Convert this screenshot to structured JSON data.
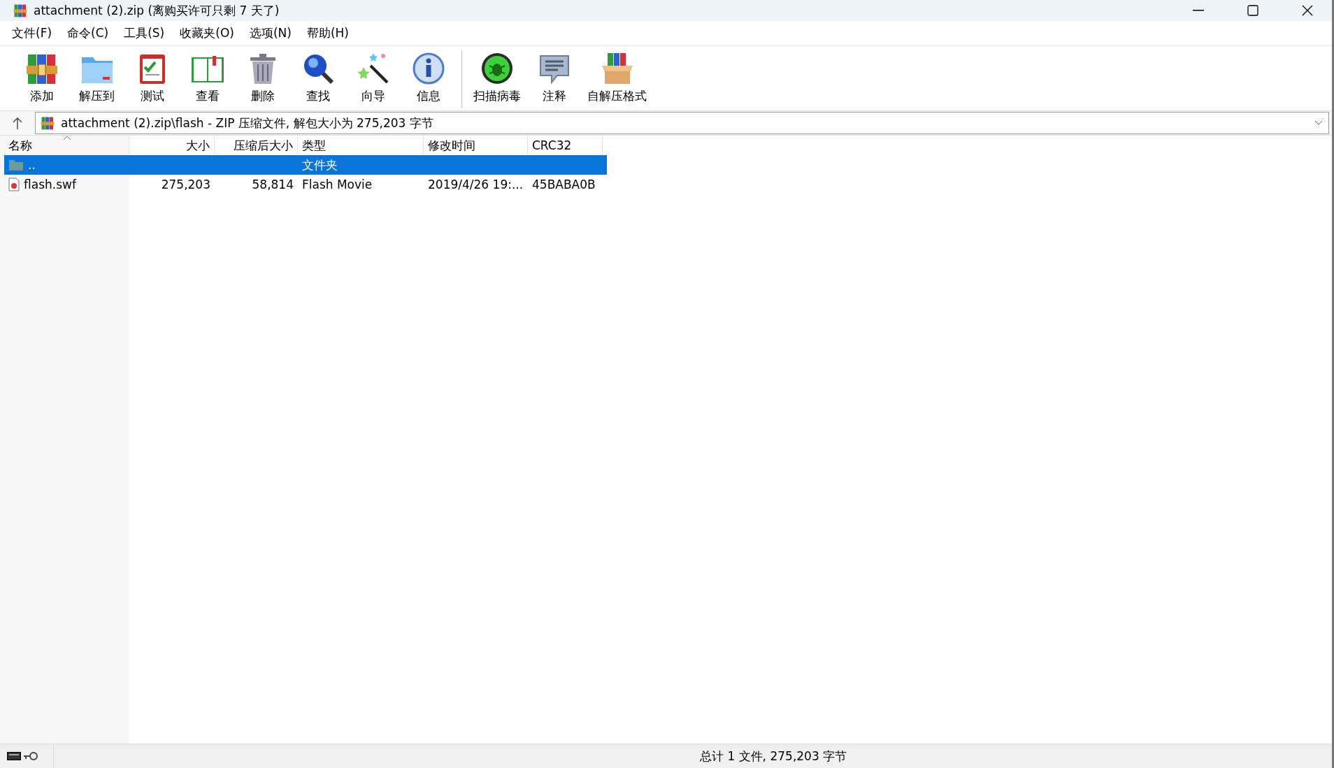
{
  "window": {
    "title": "attachment (2).zip (离购买许可只剩 7 天了)"
  },
  "menu": [
    "文件(F)",
    "命令(C)",
    "工具(S)",
    "收藏夹(O)",
    "选项(N)",
    "帮助(H)"
  ],
  "toolbar": {
    "groups": [
      {
        "buttons": [
          "添加",
          "解压到",
          "测试",
          "查看",
          "删除",
          "查找",
          "向导",
          "信息"
        ]
      },
      {
        "buttons": [
          "扫描病毒",
          "注释",
          "自解压格式"
        ]
      }
    ]
  },
  "address": {
    "value": "attachment (2).zip\\flash - ZIP 压缩文件, 解包大小为 275,203 字节"
  },
  "table": {
    "columns": [
      "名称",
      "大小",
      "压缩后大小",
      "类型",
      "修改时间",
      "CRC32"
    ],
    "rows": [
      {
        "kind": "folder",
        "selected": true,
        "cells": [
          "..",
          "",
          "",
          "文件夹",
          "",
          ""
        ]
      },
      {
        "kind": "file",
        "selected": false,
        "cells": [
          "flash.swf",
          "275,203",
          "58,814",
          "Flash Movie",
          "2019/4/26 19:...",
          "45BABA0B"
        ]
      }
    ]
  },
  "status_bar": {
    "text": "总计 1 文件, 275,203 字节"
  }
}
